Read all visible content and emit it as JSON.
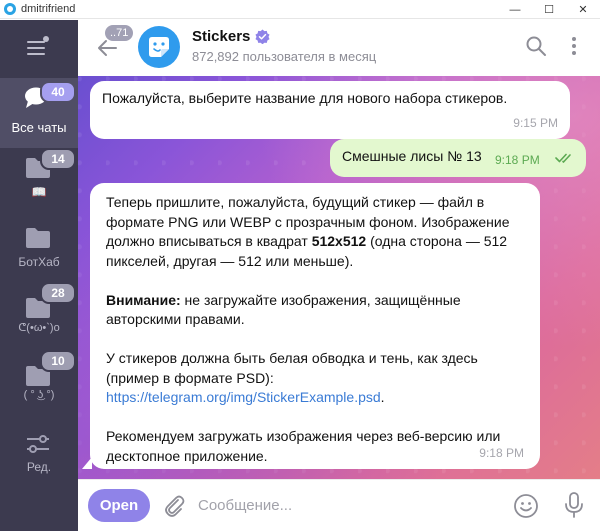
{
  "window": {
    "title": "dmitrifriend",
    "controls": {
      "minimize_icon": "—",
      "maximize_icon": "☐",
      "close_icon": "✕"
    }
  },
  "sidebar": {
    "folders": [
      {
        "label": "Все чаты",
        "badge": "40",
        "icon": "chat-bubbles-icon",
        "active": true
      },
      {
        "label": "📖",
        "badge": "14",
        "icon": "folder-icon"
      },
      {
        "label": "БотХаб",
        "badge": "",
        "icon": "folder-icon"
      },
      {
        "label": "ᕦ(•ω•`)o",
        "badge": "28",
        "icon": "folder-icon"
      },
      {
        "label": "( ° ͜ʖ °)",
        "badge": "10",
        "icon": "folder-icon"
      },
      {
        "label": "Ред.",
        "badge": "",
        "icon": "sliders-icon"
      }
    ]
  },
  "header": {
    "back_count": "..71",
    "title": "Stickers",
    "subtitle": "872,892 пользователя в месяц"
  },
  "messages": [
    {
      "direction": "in",
      "text": "Пожалуйста, выберите название для нового набора стикеров.",
      "time": "9:15 PM"
    },
    {
      "direction": "out",
      "text": "Смешные лисы № 13",
      "time": "9:18 PM"
    },
    {
      "direction": "in",
      "time": "9:18 PM",
      "p1_a": "Теперь пришлите, пожалуйста, будущий стикер — файл в формате PNG или WEBP с прозрачным фоном. Изображение должно вписываться в квадрат ",
      "p1_bold": "512x512",
      "p1_b": " (одна сторона — 512 пикселей, другая — 512 или меньше).",
      "p2_bold": "Внимание:",
      "p2_rest": " не загружайте изображения, защищённые авторскими правами.",
      "p3": "У стикеров должна быть белая обводка и тень, как здесь (пример в формате PSD):",
      "link": "https://telegram.org/img/StickerExample.psd",
      "link_suffix": ".",
      "p4": "Рекомендуем загружать изображения через веб-версию или десктопное приложение."
    }
  ],
  "compose": {
    "open_label": "Open",
    "placeholder": "Сообщение...",
    "value": ""
  },
  "colors": {
    "sidebar_bg": "#3c3a4f",
    "accent": "#8f83e8",
    "out_bubble": "#e3f8cf",
    "link": "#3a7bd5"
  }
}
